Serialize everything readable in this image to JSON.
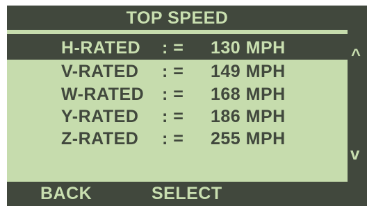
{
  "header": {
    "title": "TOP SPEED"
  },
  "list": {
    "items": [
      {
        "rating": "H-RATED",
        "separator": ": =",
        "speed": "130 MPH",
        "selected": true
      },
      {
        "rating": "V-RATED",
        "separator": ": =",
        "speed": "149 MPH",
        "selected": false
      },
      {
        "rating": "W-RATED",
        "separator": ": =",
        "speed": "168 MPH",
        "selected": false
      },
      {
        "rating": "Y-RATED",
        "separator": ": =",
        "speed": "186 MPH",
        "selected": false
      },
      {
        "rating": "Z-RATED",
        "separator": ": =",
        "speed": "255 MPH",
        "selected": false
      }
    ]
  },
  "scroll": {
    "up_icon": "^",
    "down_icon": "v"
  },
  "softkeys": {
    "back_label": "BACK",
    "select_label": "SELECT"
  },
  "colors": {
    "display_dark": "#41483d",
    "display_light": "#c6dcad"
  }
}
